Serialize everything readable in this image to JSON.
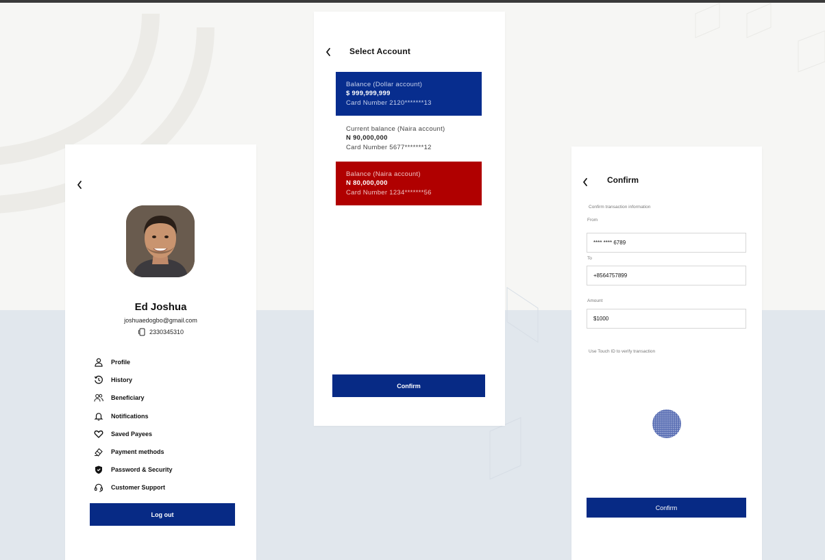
{
  "colors": {
    "primary_blue": "#072a85",
    "dollar_card": "#072d8e",
    "naira_red_card": "#b00000",
    "bg_top": "#f6f6f4",
    "bg_bottom": "#e1e7ed"
  },
  "profile": {
    "back_icon": "chevron-left-icon",
    "name": "Ed Joshua",
    "email": "joshuaedogbo@gmail.com",
    "phone": "2330345310",
    "phone_icon": "phone-icon",
    "menu": [
      {
        "label": "Profile",
        "icon": "user-icon"
      },
      {
        "label": "History",
        "icon": "history-icon"
      },
      {
        "label": "Beneficiary",
        "icon": "users-icon"
      },
      {
        "label": "Notifications",
        "icon": "bell-icon"
      },
      {
        "label": "Saved Payees",
        "icon": "heart-icon"
      },
      {
        "label": "Payment methods",
        "icon": "payment-icon"
      },
      {
        "label": "Password  & Security",
        "icon": "shield-icon"
      },
      {
        "label": "Customer Support",
        "icon": "headset-icon"
      }
    ],
    "logout_label": "Log out"
  },
  "select_account": {
    "back_icon": "chevron-left-icon",
    "title": "Select  Account",
    "accounts": [
      {
        "label": "Balance (Dollar account)",
        "amount": "$ 999,999,999",
        "card": "Card Number 2120*******13"
      },
      {
        "label": "Current balance (Naira account)",
        "amount": "N 90,000,000",
        "card": "Card Number 5677*******12"
      },
      {
        "label": "Balance (Naira account)",
        "amount": "N 80,000,000",
        "card": "Card Number 1234*******56"
      }
    ],
    "confirm_label": "Confirm"
  },
  "confirm": {
    "back_icon": "chevron-left-icon",
    "title": "Confirm",
    "info_text": "Confirm transaction information",
    "from_label": "From",
    "from_value": "**** **** 6789",
    "to_label": "To",
    "to_value": "+8564757899",
    "amount_label": "Amount",
    "amount_value": "$1000",
    "touch_text": "Use Touch ID to verify transaction",
    "fingerprint_icon": "fingerprint-icon",
    "confirm_label": "Confirm"
  }
}
